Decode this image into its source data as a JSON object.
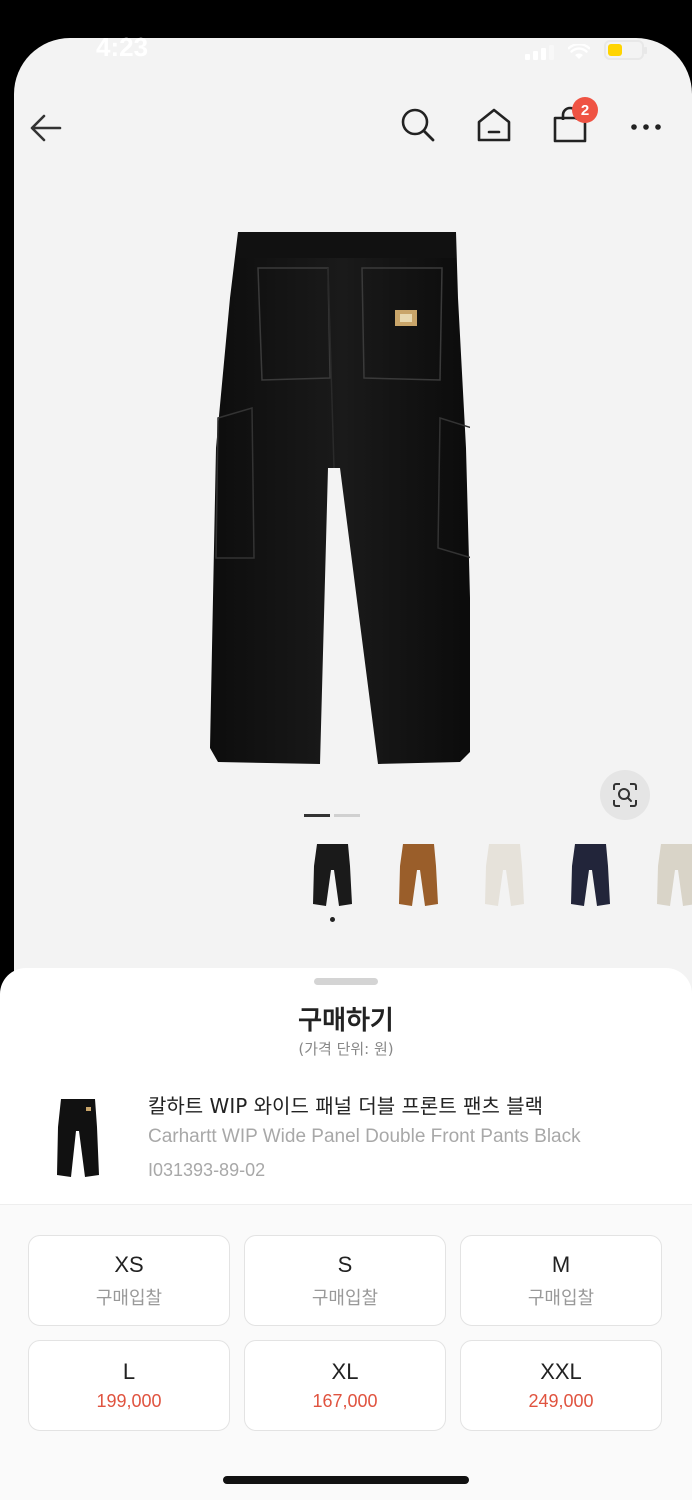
{
  "status_bar": {
    "time": "4:23"
  },
  "nav": {
    "cart_count": "2"
  },
  "colors": {
    "accent": "#ef5343",
    "bid_price": "#e0533f"
  },
  "gallery": {
    "thumbnails": [
      {
        "name": "thumb-black",
        "color": "#1a1a1a"
      },
      {
        "name": "thumb-brown",
        "color": "#9a5e2a"
      },
      {
        "name": "thumb-cream",
        "color": "#e6e2da"
      },
      {
        "name": "thumb-navy",
        "color": "#22253a"
      },
      {
        "name": "thumb-stone",
        "color": "#d9d4c8"
      }
    ]
  },
  "sheet": {
    "title": "구매하기",
    "subtitle": "(가격 단위: 원)"
  },
  "product": {
    "name_ko": "칼하트 WIP 와이드 패널 더블 프론트 팬츠 블랙",
    "name_en": "Carhartt WIP Wide Panel Double Front Pants Black",
    "code": "I031393-89-02"
  },
  "sizes": [
    {
      "size": "XS",
      "price": "구매입찰",
      "has_price": false
    },
    {
      "size": "S",
      "price": "구매입찰",
      "has_price": false
    },
    {
      "size": "M",
      "price": "구매입찰",
      "has_price": false
    },
    {
      "size": "L",
      "price": "199,000",
      "has_price": true
    },
    {
      "size": "XL",
      "price": "167,000",
      "has_price": true
    },
    {
      "size": "XXL",
      "price": "249,000",
      "has_price": true
    }
  ]
}
